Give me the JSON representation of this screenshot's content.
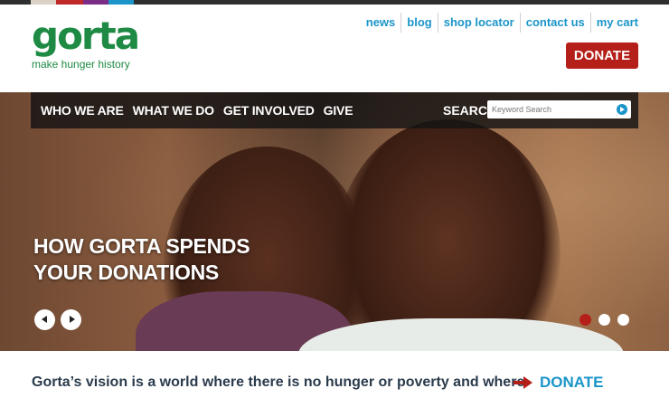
{
  "brand": {
    "name": "gorta",
    "tagline": "make hunger history",
    "green": "#1e8a43",
    "blue": "#1b95c9",
    "red": "#b51f19"
  },
  "top_strip_colors": [
    "#d9d2c4",
    "#c0282a",
    "#7b2c87",
    "#1b95c9"
  ],
  "utility_nav": {
    "items": [
      "news",
      "blog",
      "shop locator",
      "contact us",
      "my cart"
    ]
  },
  "donate_button": "DONATE",
  "main_nav": {
    "items": [
      "WHO WE ARE",
      "WHAT WE DO",
      "GET INVOLVED",
      "GIVE"
    ],
    "search_label": "SEARCH",
    "search_placeholder": "Keyword Search"
  },
  "hero": {
    "headline_line1": "HOW GORTA SPENDS",
    "headline_line2": "YOUR DONATIONS",
    "slide_count": 3,
    "active_slide": 1,
    "prev_icon": "chevron-left-icon",
    "next_icon": "chevron-right-icon"
  },
  "vision": {
    "text": "Gorta’s vision is a world where there is no hunger or poverty and where",
    "donate_label": "DONATE",
    "arrow_icon": "arrow-right-icon"
  }
}
